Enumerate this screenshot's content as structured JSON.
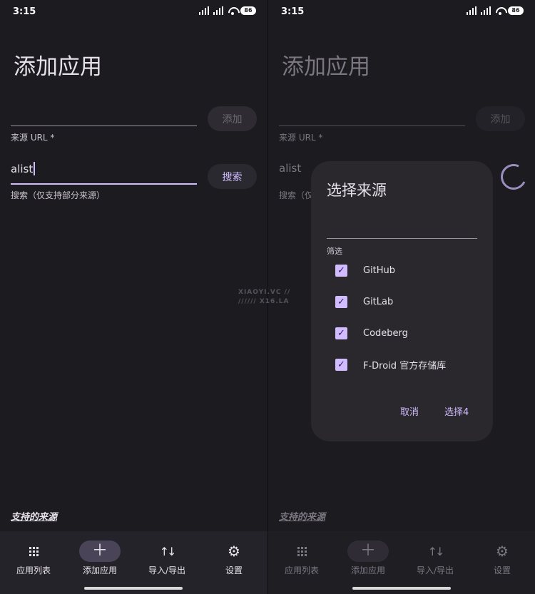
{
  "status": {
    "time": "3:15",
    "battery": "86"
  },
  "page": {
    "title": "添加应用",
    "add_button": "添加",
    "url_helper": "来源 URL *",
    "search_value": "alist",
    "search_button": "搜索",
    "search_helper": "搜索（仅支持部分来源）",
    "supported_sources": "支持的来源"
  },
  "nav": [
    {
      "label": "应用列表",
      "icon": "grid-icon",
      "active": false
    },
    {
      "label": "添加应用",
      "icon": "plus-icon",
      "active": true
    },
    {
      "label": "导入/导出",
      "icon": "swap-icon",
      "active": false
    },
    {
      "label": "设置",
      "icon": "gear-icon",
      "active": false
    }
  ],
  "dialog": {
    "title": "选择来源",
    "filter_label": "筛选",
    "options": [
      {
        "label": "GitHub",
        "checked": true
      },
      {
        "label": "GitLab",
        "checked": true
      },
      {
        "label": "Codeberg",
        "checked": true
      },
      {
        "label": "F-Droid 官方存储库",
        "checked": true
      }
    ],
    "cancel": "取消",
    "confirm": "选择4"
  },
  "watermark": {
    "line1": "XIAOYI.VC //",
    "line2": "////// X16.LA"
  },
  "colors": {
    "accent": "#d0bcff",
    "background": "#1c1b1f",
    "navbar": "#25232a",
    "dialog": "#2a282d"
  }
}
